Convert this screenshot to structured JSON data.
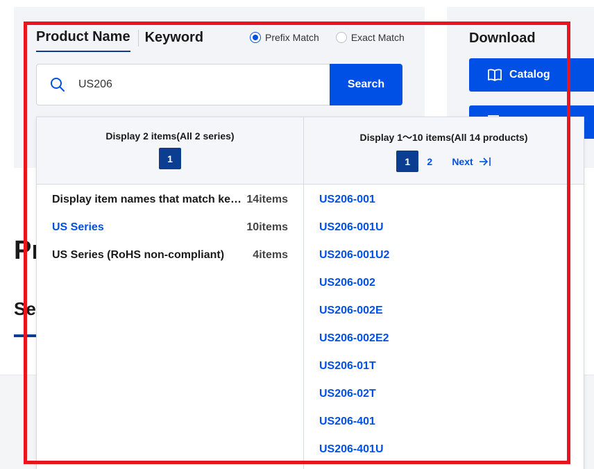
{
  "search": {
    "tabs": [
      {
        "label": "Product Name",
        "active": true
      },
      {
        "label": "Keyword",
        "active": false
      }
    ],
    "match_options": [
      {
        "label": "Prefix Match",
        "checked": true
      },
      {
        "label": "Exact Match",
        "checked": false
      }
    ],
    "query": "US206",
    "button_label": "Search"
  },
  "download": {
    "title": "Download",
    "buttons": [
      {
        "label": "Catalog",
        "icon": "book-icon"
      },
      {
        "label": "",
        "icon": "document-icon"
      }
    ]
  },
  "background": {
    "heading_partial": "Pr",
    "subheading_partial": "Se"
  },
  "results": {
    "series_panel": {
      "summary": "Display 2 items(All 2 series)",
      "pages": [
        "1"
      ],
      "current_page": "1",
      "items": [
        {
          "name": "Display item names that match key…",
          "count": "14items",
          "link": false
        },
        {
          "name": "US Series",
          "count": "10items",
          "link": true
        },
        {
          "name": "US Series (RoHS non-compliant)",
          "count": "4items",
          "link": false
        }
      ]
    },
    "products_panel": {
      "summary": "Display 1～10 items(All 14 products)",
      "pages": [
        "1",
        "2"
      ],
      "current_page": "1",
      "next_label": "Next",
      "items": [
        "US206-001",
        "US206-001U",
        "US206-001U2",
        "US206-002",
        "US206-002E",
        "US206-002E2",
        "US206-01T",
        "US206-02T",
        "US206-401",
        "US206-401U"
      ]
    }
  },
  "colors": {
    "accent": "#0050e6",
    "navy": "#0b3d91",
    "highlight": "#e8141e"
  }
}
